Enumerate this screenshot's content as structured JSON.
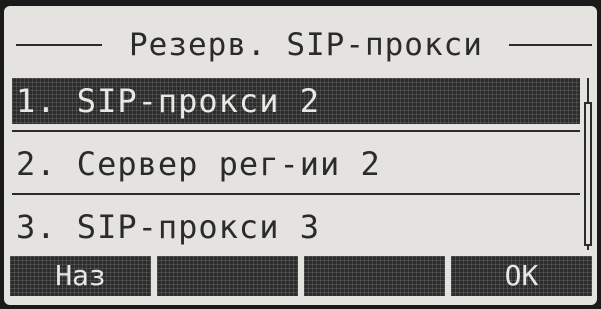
{
  "screen": {
    "title": "Резерв. SIP-прокси"
  },
  "menu": {
    "items": [
      {
        "label": "1. SIP-прокси 2",
        "selected": true
      },
      {
        "label": "2. Сервер рег-ии 2",
        "selected": false
      },
      {
        "label": "3. SIP-прокси 3",
        "selected": false
      }
    ]
  },
  "softkeys": {
    "back_label": "Наз",
    "key2_label": "",
    "key3_label": "",
    "ok_label": "OK"
  },
  "colors": {
    "background": "#e4e3df",
    "foreground": "#2b2b2b",
    "highlight": "#2c2c2c"
  }
}
